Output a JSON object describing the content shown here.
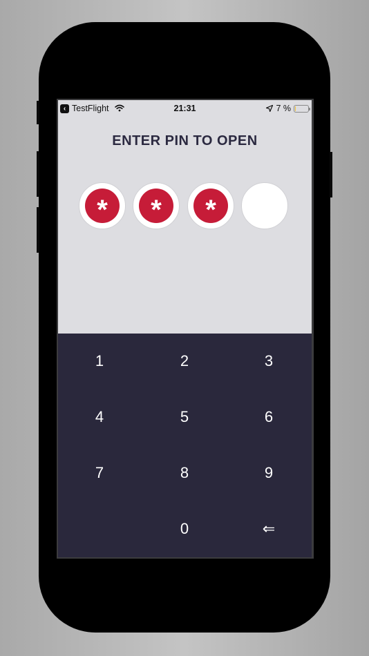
{
  "status_bar": {
    "back_app": "TestFlight",
    "time": "21:31",
    "battery": "7 %",
    "battery_level": 0.07
  },
  "title": "ENTER PIN TO OPEN",
  "pin": {
    "length": 4,
    "entered": 3,
    "mask_char": "*"
  },
  "keypad": {
    "keys": [
      "1",
      "2",
      "3",
      "4",
      "5",
      "6",
      "7",
      "8",
      "9",
      "",
      "0",
      "⇐"
    ]
  },
  "colors": {
    "background_top": "#dddde1",
    "keypad_bg": "#2a283c",
    "pin_filled": "#c61c38",
    "title": "#2b2940"
  }
}
